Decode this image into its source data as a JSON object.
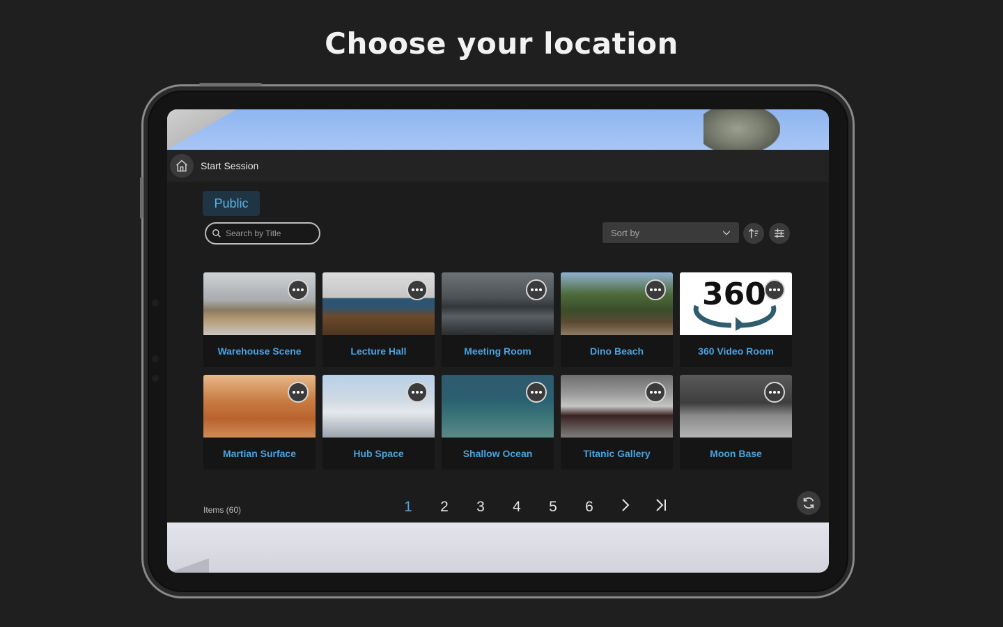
{
  "hero": {
    "title": "Choose your location"
  },
  "topbar": {
    "label": "Start Session"
  },
  "tabs": {
    "public_label": "Public"
  },
  "search": {
    "placeholder": "Search by Title"
  },
  "sort": {
    "label": "Sort by"
  },
  "locations": [
    {
      "label": "Warehouse Scene"
    },
    {
      "label": "Lecture Hall"
    },
    {
      "label": "Meeting Room"
    },
    {
      "label": "Dino Beach"
    },
    {
      "label": "360 Video Room",
      "thumb_text": "360"
    },
    {
      "label": "Martian Surface"
    },
    {
      "label": "Hub Space"
    },
    {
      "label": "Shallow Ocean"
    },
    {
      "label": "Titanic Gallery"
    },
    {
      "label": "Moon Base"
    }
  ],
  "footer": {
    "items_count": "Items (60)",
    "pages": [
      "1",
      "2",
      "3",
      "4",
      "5",
      "6"
    ],
    "active_page": "1"
  },
  "colors": {
    "accent": "#4aa3e0",
    "background": "#1f1f1f"
  }
}
